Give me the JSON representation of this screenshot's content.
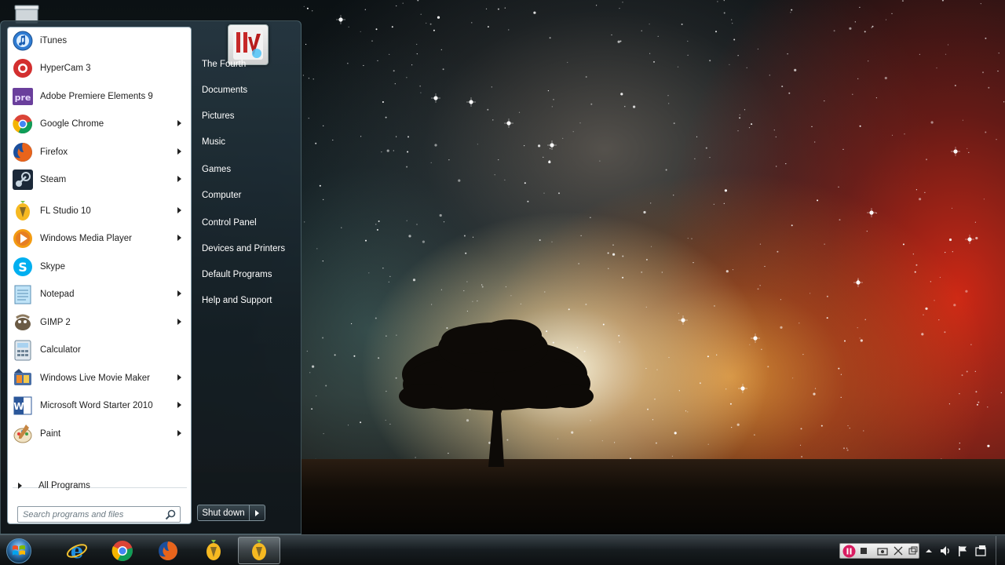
{
  "start_menu": {
    "programs": [
      {
        "label": "iTunes",
        "icon": "itunes-icon",
        "has_arrow": false
      },
      {
        "label": "HyperCam 3",
        "icon": "hypercam-icon",
        "has_arrow": false
      },
      {
        "label": "Adobe Premiere Elements 9",
        "icon": "premiere-icon",
        "has_arrow": false
      },
      {
        "label": "Google Chrome",
        "icon": "chrome-icon",
        "has_arrow": true
      },
      {
        "label": "Firefox",
        "icon": "firefox-icon",
        "has_arrow": true
      },
      {
        "label": "Steam",
        "icon": "steam-icon",
        "has_arrow": true
      },
      {
        "label": "FL Studio 10",
        "icon": "fl-studio-icon",
        "has_arrow": true
      },
      {
        "label": "Windows Media Player",
        "icon": "media-player-icon",
        "has_arrow": true
      },
      {
        "label": "Skype",
        "icon": "skype-icon",
        "has_arrow": false
      },
      {
        "label": "Notepad",
        "icon": "notepad-icon",
        "has_arrow": true
      },
      {
        "label": "GIMP 2",
        "icon": "gimp-icon",
        "has_arrow": true
      },
      {
        "label": "Calculator",
        "icon": "calculator-icon",
        "has_arrow": false
      },
      {
        "label": "Windows Live Movie Maker",
        "icon": "movie-maker-icon",
        "has_arrow": true
      },
      {
        "label": "Microsoft Word Starter 2010",
        "icon": "word-icon",
        "has_arrow": true
      },
      {
        "label": "Paint",
        "icon": "paint-icon",
        "has_arrow": true
      }
    ],
    "all_programs_label": "All Programs",
    "search_placeholder": "Search programs and files",
    "right_items": [
      "The Fourth",
      "Documents",
      "Pictures",
      "Music",
      "Games",
      "Computer",
      "Control Panel",
      "Devices and Printers",
      "Default Programs",
      "Help and Support"
    ],
    "shutdown_label": "Shut down"
  },
  "taskbar": {
    "pinned": [
      "internet-explorer-icon",
      "chrome-icon",
      "firefox-icon",
      "fl-studio-icon",
      "fl-studio-icon"
    ],
    "tray_icons": [
      "recorder-pause-icon",
      "recorder-stop-icon",
      "recorder-camera-icon",
      "recorder-cursor-icon",
      "recorder-window-icon",
      "show-hidden-icons-chevron",
      "volume-icon",
      "flag-icon",
      "action-center-icon"
    ]
  },
  "colors": {
    "menu_text_dark": "#1e1e1e",
    "menu_text_light": "#ffffff",
    "start_menu_frame": "#283a44"
  }
}
